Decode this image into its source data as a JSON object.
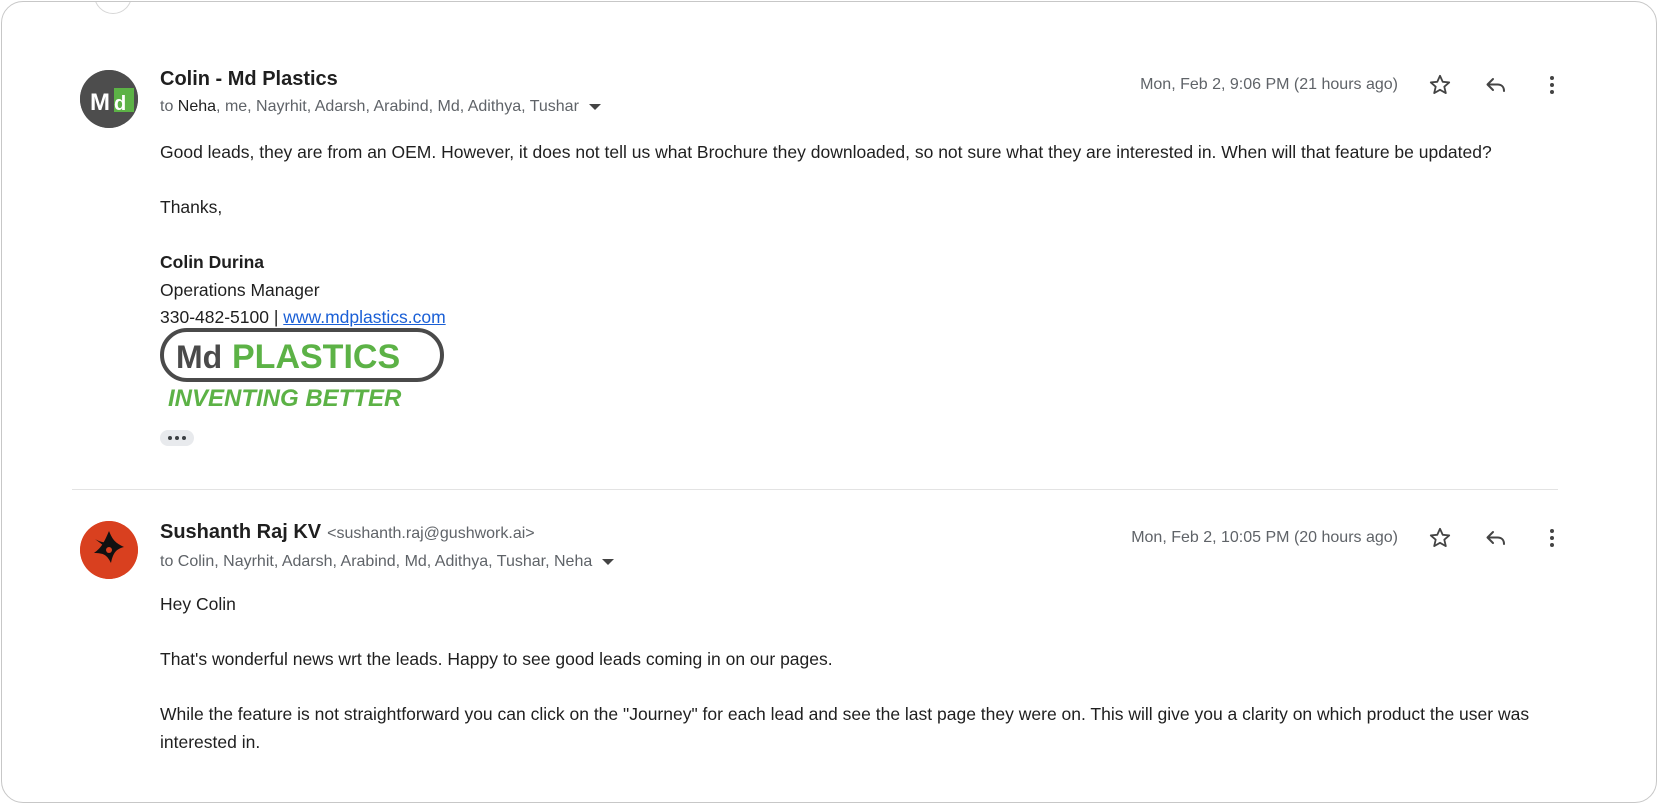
{
  "messages": [
    {
      "sender_name": "Colin - Md Plastics",
      "recipients_first": "Neha",
      "recipients_rest": ", me, Nayrhit, Adarsh, Arabind, Md, Adithya, Tushar",
      "recipients_prefix": "to ",
      "date": "Mon, Feb 2, 9:06 PM (21 hours ago)",
      "avatar_text": "Md",
      "body": {
        "line1": "Good leads, they are from an OEM. However, it does not tell us what Brochure they downloaded, so not sure what they are interested in. When will that feature be updated?",
        "thanks": "Thanks,",
        "sig_name": "Colin Durina",
        "sig_title": "Operations Manager",
        "sig_phone": "330-482-5100 | ",
        "sig_link": "www.mdplastics.com"
      },
      "logo": {
        "mark": "Md",
        "name": "PLASTICS",
        "tagline": "INVENTING BETTER"
      }
    },
    {
      "sender_name": "Sushanth Raj KV",
      "sender_email": "<sushanth.raj@gushwork.ai>",
      "recipients": "to Colin, Nayrhit, Adarsh, Arabind, Md, Adithya, Tushar, Neha",
      "date": "Mon, Feb 2, 10:05 PM (20 hours ago)",
      "body": {
        "greeting": "Hey Colin",
        "para1": "That's wonderful news wrt the leads. Happy to see good leads coming in on our pages.",
        "para2": "While the feature is not straightforward you can click on the \"Journey\" for each lead and see the last page they were on. This will give you a clarity on which product the user was interested in."
      }
    }
  ],
  "icons": {
    "star": "star-icon",
    "reply": "reply-icon",
    "more": "more-vert-icon",
    "expand": "expand-recipients-icon",
    "trimmed": "show-trimmed-content-icon"
  },
  "colors": {
    "logo_green": "#5cb246",
    "logo_gray": "#4a4a4a",
    "link": "#1a5fd6",
    "avatar2_bg": "#d9401f"
  }
}
